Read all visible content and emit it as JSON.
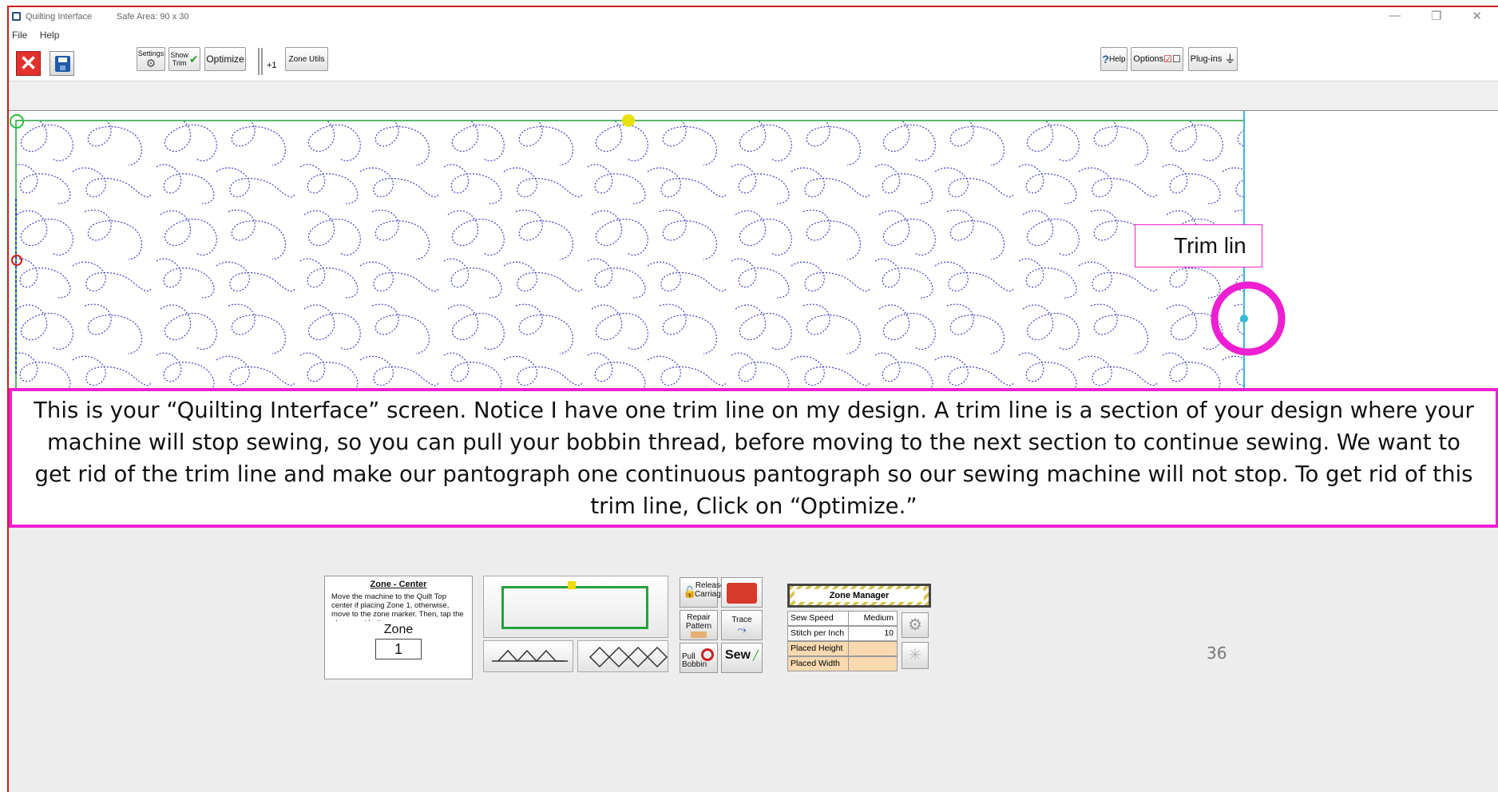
{
  "window": {
    "title": "Quilting Interface",
    "safe_area": "Safe Area:  90 x 30"
  },
  "menu": [
    "File",
    "Help"
  ],
  "toolbar": {
    "settings": "Settings",
    "show_trim_line1": "Show",
    "show_trim_line2": "Trim",
    "optimize": "Optimize",
    "plus_one": "+1",
    "zone_utils": "Zone Utils",
    "help": "Help",
    "options": "Options",
    "plugins": "Plug-ins"
  },
  "annotations": {
    "trim_label": "Trim lin",
    "callout": "This is your “Quilting Interface” screen.  Notice I have one trim line on my design.  A trim line is a section of your design where your machine will stop sewing, so you can pull your bobbin thread, before moving to the next section to continue sewing.  We want to get rid of the trim line and make our pantograph one continuous pantograph so our sewing machine will not stop.  To get rid of this trim line, Click on “Optimize.”"
  },
  "zone_panel": {
    "title": "Zone - Center",
    "description": "Move the machine to the Quilt Top center if placing Zone 1, otherwise, move to the zone marker. Then, tap the placement button",
    "zone_label": "Zone",
    "zone_value": "1"
  },
  "controls": {
    "release_carriage_1": "Release",
    "release_carriage_2": "Carriage",
    "repair_pattern_1": "Repair",
    "repair_pattern_2": "Pattern",
    "trace": "Trace",
    "pull_bobbin_1": "Pull",
    "pull_bobbin_2": "Bobbin",
    "sew": "Sew"
  },
  "zone_manager": {
    "title": "Zone Manager",
    "rows": [
      {
        "label": "Sew Speed",
        "value": "Medium"
      },
      {
        "label": "Stitch per Inch",
        "value": "10"
      },
      {
        "label": "Placed Height",
        "value": ""
      },
      {
        "label": "Placed Width",
        "value": ""
      }
    ]
  },
  "page_number": "36",
  "colors": {
    "stitch": "#3b3bd6",
    "callout_border": "#ee1fd2",
    "trim_marker": "#ee1fd2",
    "zone_border": "#23a23a"
  }
}
